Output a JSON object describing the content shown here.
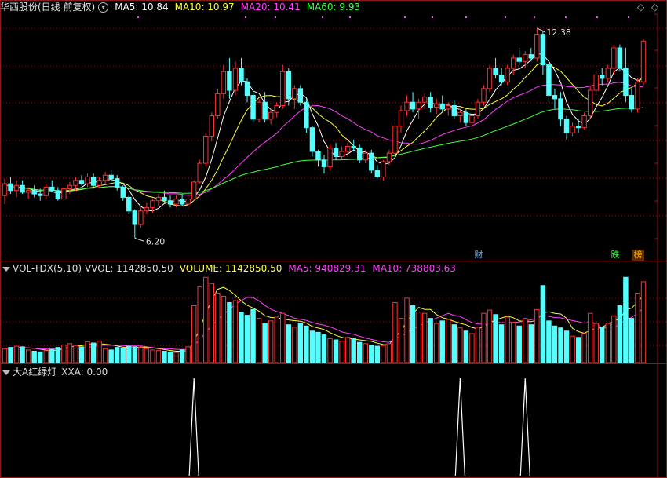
{
  "header": {
    "stock_title": "华西股份(日线 前复权)",
    "ma_labels": [
      {
        "text": "MA5: 10.84",
        "color": "#ffffff"
      },
      {
        "text": "MA10: 10.97",
        "color": "#ffff3c"
      },
      {
        "text": "MA20: 10.41",
        "color": "#ff40ff"
      },
      {
        "text": "MA60: 9.93",
        "color": "#3cff3c"
      }
    ]
  },
  "volume_header": {
    "indicator": "VOL-TDX(5,10)",
    "items": [
      {
        "text": "VVOL: 1142850.50",
        "color": "#dddddd"
      },
      {
        "text": "VOLUME: 1142850.50",
        "color": "#ffff3c"
      },
      {
        "text": "MA5: 940829.31",
        "color": "#ff40ff"
      },
      {
        "text": "MA10: 738803.63",
        "color": "#ff40ff"
      }
    ]
  },
  "signal_header": {
    "indicator": "大A红绿灯",
    "value": "XXA: 0.00"
  },
  "markers": {
    "financial": "财",
    "drop": "跌",
    "list": "榜"
  },
  "chart_data": [
    {
      "type": "candlestick",
      "title": "华西股份(日线 前复权)",
      "price_high_label": "12.38",
      "price_low_label": "6.20",
      "ylim": [
        6.0,
        12.7
      ],
      "ohlc": [
        [
          7.45,
          7.95,
          7.2,
          7.8
        ],
        [
          7.8,
          8.0,
          7.5,
          7.6
        ],
        [
          7.6,
          7.9,
          7.4,
          7.75
        ],
        [
          7.75,
          7.9,
          7.5,
          7.55
        ],
        [
          7.55,
          7.7,
          7.35,
          7.6
        ],
        [
          7.6,
          7.75,
          7.4,
          7.5
        ],
        [
          7.5,
          7.65,
          7.3,
          7.45
        ],
        [
          7.45,
          7.8,
          7.35,
          7.7
        ],
        [
          7.7,
          7.9,
          7.55,
          7.6
        ],
        [
          7.6,
          7.7,
          7.3,
          7.35
        ],
        [
          7.35,
          7.7,
          7.3,
          7.65
        ],
        [
          7.65,
          7.85,
          7.5,
          7.75
        ],
        [
          7.75,
          8.0,
          7.6,
          7.9
        ],
        [
          7.9,
          8.05,
          7.75,
          7.8
        ],
        [
          7.8,
          8.1,
          7.7,
          8.0
        ],
        [
          8.0,
          8.1,
          7.7,
          7.75
        ],
        [
          7.75,
          8.0,
          7.65,
          7.9
        ],
        [
          7.9,
          8.15,
          7.8,
          8.05
        ],
        [
          8.05,
          8.2,
          7.85,
          7.95
        ],
        [
          7.95,
          8.05,
          7.6,
          7.7
        ],
        [
          7.7,
          7.75,
          7.3,
          7.4
        ],
        [
          7.4,
          7.45,
          6.9,
          7.0
        ],
        [
          7.0,
          7.05,
          6.2,
          6.6
        ],
        [
          6.6,
          7.1,
          6.5,
          7.0
        ],
        [
          7.0,
          7.25,
          6.9,
          7.1
        ],
        [
          7.1,
          7.35,
          6.95,
          7.3
        ],
        [
          7.3,
          7.5,
          7.15,
          7.4
        ],
        [
          7.4,
          7.6,
          7.25,
          7.3
        ],
        [
          7.3,
          7.45,
          7.1,
          7.2
        ],
        [
          7.2,
          7.45,
          7.1,
          7.35
        ],
        [
          7.35,
          7.5,
          7.15,
          7.2
        ],
        [
          7.2,
          7.4,
          7.05,
          7.35
        ],
        [
          7.35,
          7.9,
          7.3,
          7.85
        ],
        [
          7.85,
          8.5,
          7.8,
          8.4
        ],
        [
          8.4,
          9.3,
          8.3,
          9.2
        ],
        [
          9.2,
          9.9,
          9.05,
          9.8
        ],
        [
          9.8,
          10.6,
          9.7,
          10.45
        ],
        [
          10.45,
          11.3,
          10.3,
          11.1
        ],
        [
          11.1,
          11.5,
          10.3,
          10.55
        ],
        [
          10.55,
          11.4,
          10.4,
          11.2
        ],
        [
          11.2,
          11.5,
          10.7,
          10.8
        ],
        [
          10.8,
          10.9,
          10.2,
          10.4
        ],
        [
          10.4,
          10.5,
          9.6,
          9.7
        ],
        [
          9.7,
          10.3,
          9.6,
          10.2
        ],
        [
          10.2,
          10.5,
          9.6,
          9.7
        ],
        [
          9.7,
          10.0,
          9.55,
          9.9
        ],
        [
          9.9,
          10.2,
          9.75,
          10.1
        ],
        [
          10.1,
          11.3,
          10.0,
          11.1
        ],
        [
          11.1,
          11.2,
          10.1,
          10.3
        ],
        [
          10.3,
          10.7,
          10.0,
          10.6
        ],
        [
          10.6,
          10.7,
          10.1,
          10.2
        ],
        [
          10.2,
          10.3,
          9.3,
          9.45
        ],
        [
          9.45,
          9.5,
          8.6,
          8.75
        ],
        [
          8.75,
          8.8,
          8.3,
          8.5
        ],
        [
          8.5,
          8.65,
          8.1,
          8.3
        ],
        [
          8.3,
          8.95,
          8.2,
          8.85
        ],
        [
          8.85,
          9.0,
          8.5,
          8.6
        ],
        [
          8.6,
          8.9,
          8.5,
          8.75
        ],
        [
          8.75,
          9.0,
          8.6,
          8.9
        ],
        [
          8.9,
          9.1,
          8.75,
          8.85
        ],
        [
          8.85,
          8.95,
          8.4,
          8.5
        ],
        [
          8.5,
          8.8,
          8.4,
          8.7
        ],
        [
          8.7,
          8.8,
          8.1,
          8.2
        ],
        [
          8.2,
          8.35,
          7.95,
          8.0
        ],
        [
          8.0,
          8.5,
          7.9,
          8.45
        ],
        [
          8.45,
          8.8,
          8.35,
          8.7
        ],
        [
          8.7,
          9.6,
          8.6,
          9.5
        ],
        [
          9.5,
          10.1,
          9.3,
          9.95
        ],
        [
          9.95,
          10.4,
          9.8,
          10.2
        ],
        [
          10.2,
          10.5,
          9.9,
          10.0
        ],
        [
          10.0,
          10.3,
          9.7,
          10.2
        ],
        [
          10.2,
          10.45,
          10.0,
          10.35
        ],
        [
          10.35,
          10.5,
          9.9,
          10.05
        ],
        [
          10.05,
          10.3,
          9.85,
          10.15
        ],
        [
          10.15,
          10.4,
          9.9,
          10.0
        ],
        [
          10.0,
          10.2,
          9.8,
          10.1
        ],
        [
          10.1,
          10.25,
          9.7,
          9.8
        ],
        [
          9.8,
          10.0,
          9.6,
          9.9
        ],
        [
          9.9,
          10.0,
          9.5,
          9.6
        ],
        [
          9.6,
          9.9,
          9.4,
          9.8
        ],
        [
          9.8,
          10.3,
          9.7,
          10.2
        ],
        [
          10.2,
          10.7,
          10.1,
          10.6
        ],
        [
          10.6,
          11.3,
          10.5,
          11.2
        ],
        [
          11.2,
          11.5,
          10.9,
          11.0
        ],
        [
          11.0,
          11.2,
          10.7,
          10.8
        ],
        [
          10.8,
          11.3,
          10.7,
          11.2
        ],
        [
          11.2,
          11.6,
          11.0,
          11.5
        ],
        [
          11.5,
          11.8,
          11.3,
          11.4
        ],
        [
          11.4,
          11.7,
          11.2,
          11.6
        ],
        [
          11.6,
          11.8,
          11.4,
          11.5
        ],
        [
          11.5,
          12.38,
          11.4,
          12.2
        ],
        [
          12.2,
          12.3,
          11.0,
          11.3
        ],
        [
          11.3,
          11.4,
          10.2,
          10.4
        ],
        [
          10.4,
          10.6,
          10.0,
          10.3
        ],
        [
          10.3,
          10.5,
          9.5,
          9.7
        ],
        [
          9.7,
          9.8,
          9.1,
          9.3
        ],
        [
          9.3,
          9.6,
          9.2,
          9.5
        ],
        [
          9.5,
          9.7,
          9.3,
          9.45
        ],
        [
          9.45,
          9.9,
          9.4,
          9.8
        ],
        [
          9.8,
          10.7,
          9.7,
          10.55
        ],
        [
          10.55,
          11.1,
          10.4,
          11.0
        ],
        [
          11.0,
          11.2,
          10.7,
          10.9
        ],
        [
          10.9,
          11.3,
          10.8,
          11.2
        ],
        [
          11.2,
          11.9,
          11.0,
          11.8
        ],
        [
          11.8,
          11.9,
          11.1,
          11.2
        ],
        [
          11.2,
          11.8,
          10.2,
          10.4
        ],
        [
          10.4,
          10.6,
          9.9,
          10.0
        ],
        [
          10.0,
          10.9,
          9.9,
          10.8
        ],
        [
          10.8,
          12.05,
          10.7,
          12.0
        ]
      ],
      "ma_lines": [
        {
          "name": "MA5",
          "color": "#ffffff",
          "last": 10.84
        },
        {
          "name": "MA10",
          "color": "#ffff3c",
          "last": 10.97
        },
        {
          "name": "MA20",
          "color": "#ff40ff",
          "last": 10.41
        },
        {
          "name": "MA60",
          "color": "#3cff3c",
          "last": 9.93
        }
      ]
    },
    {
      "type": "bar",
      "title": "VOL-TDX(5,10)",
      "values": [
        22,
        24,
        26,
        25,
        20,
        18,
        17,
        19,
        21,
        24,
        28,
        30,
        27,
        25,
        33,
        31,
        34,
        22,
        20,
        24,
        23,
        26,
        25,
        24,
        22,
        20,
        19,
        18,
        17,
        16,
        20,
        25,
        90,
        120,
        135,
        125,
        110,
        105,
        95,
        98,
        80,
        75,
        84,
        70,
        62,
        66,
        72,
        78,
        60,
        56,
        62,
        58,
        50,
        48,
        44,
        38,
        36,
        34,
        40,
        38,
        32,
        30,
        28,
        26,
        27,
        30,
        95,
        70,
        102,
        90,
        80,
        78,
        70,
        62,
        66,
        68,
        60,
        55,
        50,
        46,
        56,
        78,
        83,
        76,
        60,
        72,
        64,
        58,
        70,
        60,
        84,
        122,
        66,
        58,
        55,
        50,
        42,
        40,
        46,
        78,
        62,
        56,
        62,
        74,
        90,
        135,
        70,
        110,
        128
      ],
      "ma5_last": 940829.31,
      "ma10_last": 738803.63,
      "last_volume": 1142850.5
    },
    {
      "type": "line",
      "title": "大A红绿灯",
      "series_label": "XXA",
      "last_value": 0.0,
      "spike_bar_indices": [
        32,
        77,
        88
      ],
      "ylim": [
        0,
        1
      ]
    }
  ]
}
